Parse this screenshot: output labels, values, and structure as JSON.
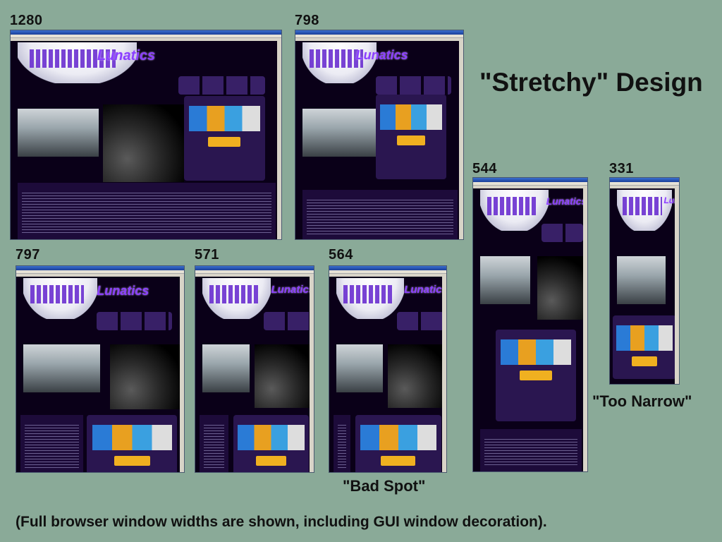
{
  "slide": {
    "title": "\"Stretchy\" Design",
    "footnote": "(Full browser window widths are shown, including GUI window decoration)."
  },
  "screenshots": [
    {
      "width_label": "1280",
      "logo": "Lunatics"
    },
    {
      "width_label": "798",
      "logo": "Lunatics"
    },
    {
      "width_label": "544",
      "logo": "Lunatics"
    },
    {
      "width_label": "331",
      "logo": "Lunatics",
      "caption": "\"Too Narrow\""
    },
    {
      "width_label": "797",
      "logo": "Lunatics"
    },
    {
      "width_label": "571",
      "logo": "Lunatics"
    },
    {
      "width_label": "564",
      "logo": "Lunatics",
      "caption": "\"Bad Spot\""
    }
  ],
  "colors": {
    "background": "#8aaa98",
    "window_title": "#2b5fc4",
    "page_bg": "#0a0018",
    "accent_purple": "#8b3fff",
    "accent_green": "#7dff5a"
  }
}
